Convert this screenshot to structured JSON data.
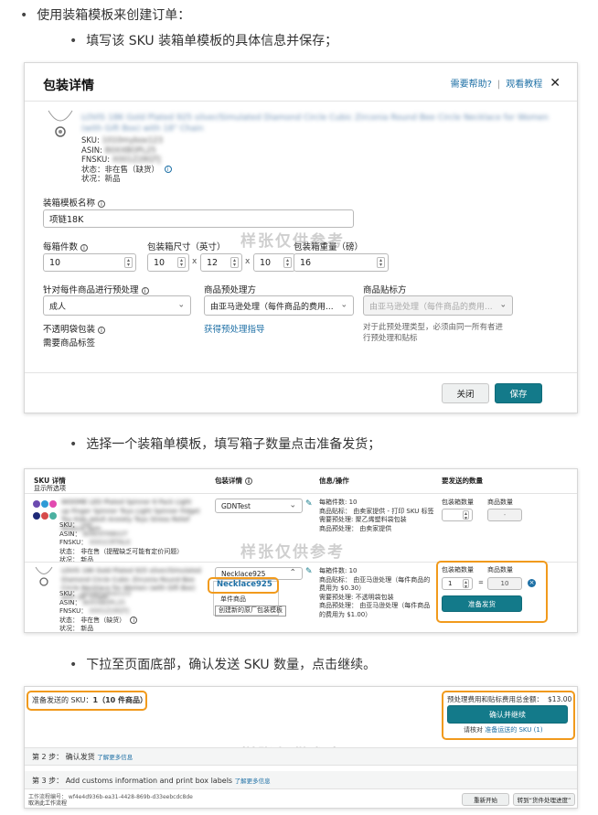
{
  "steps": {
    "step1": "使用装箱模板来创建订单：",
    "step1a": "填写该 SKU 装箱单模板的具体信息并保存；",
    "step2": "选择一个装箱单模板，填写箱子数量点击准备发货；",
    "step3": "下拉至页面底部，确认发送 SKU 数量，点击继续。"
  },
  "watermark": "样张仅供参考",
  "modal": {
    "title": "包装详情",
    "help": "需要帮助?",
    "tutorial": "观看教程",
    "close": "✕",
    "product_title": "LOVIS 18K Gold Plated 925 silver/Simulated Diamond Circle Cubic Zirconia Round Bee Circle Necklace for Women (with Gift Box) with 18\" Chain",
    "sku_label": "SKU:",
    "sku_value": "1010mybox123",
    "asin_label": "ASIN:",
    "asin_value": "B0XXBOPL25",
    "fnsku_label": "FNSKU:",
    "fnsku_value": "X001Z28QTJ",
    "status_label": "状态：",
    "status_value": "非在售（缺货）",
    "condition_label": "状况：",
    "condition_value": "新品",
    "template_name_label": "装箱模板名称",
    "template_name_value": "项链18K",
    "units_label": "每箱件数",
    "units_value": "10",
    "dims_label": "包装箱尺寸（英寸）",
    "dim1": "10",
    "dim2": "12",
    "dim3": "10",
    "x": "x",
    "weight_label": "包装箱重量（磅）",
    "weight_value": "16",
    "prep_label": "针对每件商品进行预处理",
    "prep_value": "成人",
    "prep_by_label": "商品预处理方",
    "prep_by_value": "由亚马逊处理（每件商品的费用...",
    "label_by_label": "商品贴标方",
    "label_by_value": "由亚马逊处理（每件商品的费用...",
    "opaque_bag": "不透明袋包装",
    "needs_label": "需要商品标签",
    "prep_guide": "获得预处理指导",
    "note": "对于此预处理类型，必须由同一所有者进行预处理和贴标",
    "btn_close": "关闭",
    "btn_save": "保存"
  },
  "table": {
    "col_sku": "SKU 详情",
    "show_options": "显示所选项",
    "col_pack": "包装详情",
    "col_info": "信息/操作",
    "col_qty": "要发送的数量",
    "row1": {
      "title": "WOOME LED Plated Spinner 6 Pack Light up Finger Spinner Toys Light Spinner Fidget Toy Kids Adult Anxiety Toys Stress Relief Reduce Spin",
      "sku": "SKU：",
      "sku_v": "1KF",
      "asin": "ASIN：",
      "asin_v": "B0WXFMB02T",
      "fnsku": "FNSKU：",
      "fnsku_v": "X001CRTNLK",
      "status": "状态：  非在售（提醒缺乏可能有定价问题）",
      "condition": "状况：  新品",
      "template": "GDNTest",
      "info1": "每箱件数: 10",
      "info2": "商品贴标：  由卖家提供 - 打印 SKU 标签",
      "info3": "需要预处理: 聚乙烯塑料袋包装",
      "info4": "商品预处理：  由卖家提供",
      "h_boxes": "包装箱数量",
      "h_units": "商品数量",
      "units": "-"
    },
    "row2": {
      "title": "LOVIS 18K Gold Plated 925 silver/Simulated Diamond Circle Cubic Zirconia Round Bee Circle Necklace for Women (with Gift Box) with 18\" Chain",
      "sku": "SKU：",
      "sku_v": "1010mybox123",
      "asin": "ASIN：",
      "asin_v": "B0XXBOPL25",
      "fnsku": "FNSKU：",
      "fnsku_v": "X001Z28QTJ",
      "status": "状态：  非在售（缺货）",
      "condition": "状况：  新品",
      "template": "Necklace925",
      "dd_selected": "Necklace925",
      "dd_single": "单件商品",
      "dd_create": "创建新的原厂包装模板",
      "info1": "每箱件数: 10",
      "info2": "商品贴标：  由亚马逊处理（每件商品的费用为 $0.30）",
      "info3": "需要预处理: 不透明袋包装",
      "info4": "商品预处理：  由亚马逊处理（每件商品的费用为 $1.00）",
      "h_boxes": "包装箱数量",
      "h_units": "商品数量",
      "boxes": "1",
      "eq": "=",
      "units": "10",
      "btn": "准备发货"
    }
  },
  "bottom": {
    "ready_label": "准备发送的 SKU：",
    "ready_value": "1（10 件商品）",
    "fee_label": "预处理费用和贴标费用总金额：",
    "fee_value": "$13.00",
    "btn_confirm": "确认并继续",
    "verify": "请核对",
    "verify_link": "准备运送的 SKU (1)",
    "step2": "第 2 步：  确认发货",
    "step2_link": "了解更多信息",
    "step3": "第 3 步：  Add customs information and print box labels",
    "step3_link": "了解更多信息",
    "workflow": "工作流程编号：  wf4e4d936b-ea31-4428-869b-d33eebcdc8de",
    "cancel_workflow": "取消此工作流程",
    "btn_restart": "重新开始",
    "btn_goto": "转到“货件处理进度”"
  }
}
